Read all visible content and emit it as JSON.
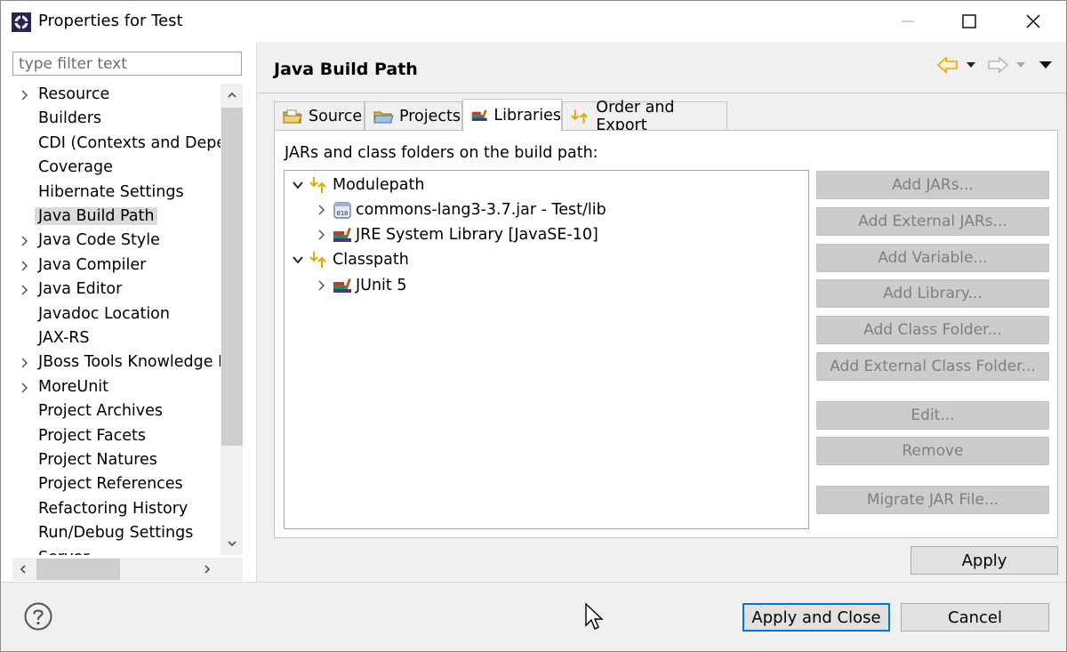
{
  "window": {
    "title": "Properties for Test"
  },
  "sidebar": {
    "filter_placeholder": "type filter text",
    "items": [
      {
        "label": "Resource",
        "expandable": true
      },
      {
        "label": "Builders",
        "expandable": false
      },
      {
        "label": "CDI (Contexts and Depen",
        "expandable": false
      },
      {
        "label": "Coverage",
        "expandable": false
      },
      {
        "label": "Hibernate Settings",
        "expandable": false
      },
      {
        "label": "Java Build Path",
        "expandable": false,
        "selected": true
      },
      {
        "label": "Java Code Style",
        "expandable": true
      },
      {
        "label": "Java Compiler",
        "expandable": true
      },
      {
        "label": "Java Editor",
        "expandable": true
      },
      {
        "label": "Javadoc Location",
        "expandable": false
      },
      {
        "label": "JAX-RS",
        "expandable": false
      },
      {
        "label": "JBoss Tools Knowledge B",
        "expandable": true
      },
      {
        "label": "MoreUnit",
        "expandable": true
      },
      {
        "label": "Project Archives",
        "expandable": false
      },
      {
        "label": "Project Facets",
        "expandable": false
      },
      {
        "label": "Project Natures",
        "expandable": false
      },
      {
        "label": "Project References",
        "expandable": false
      },
      {
        "label": "Refactoring History",
        "expandable": false
      },
      {
        "label": "Run/Debug Settings",
        "expandable": false
      },
      {
        "label": "Server",
        "expandable": false
      }
    ]
  },
  "main": {
    "title": "Java Build Path",
    "tabs": [
      {
        "label": "Source",
        "icon": "source-folder-icon"
      },
      {
        "label": "Projects",
        "icon": "projects-folder-icon"
      },
      {
        "label": "Libraries",
        "icon": "libraries-icon",
        "active": true
      },
      {
        "label": "Order and Export",
        "icon": "order-export-icon"
      }
    ],
    "build_path_label": "JARs and class folders on the build path:",
    "entries": [
      {
        "label": "Modulepath",
        "level": 0,
        "expanded": true,
        "icon": "modulepath-icon"
      },
      {
        "label": "commons-lang3-3.7.jar - Test/lib",
        "level": 1,
        "expanded": false,
        "icon": "jar-icon"
      },
      {
        "label": "JRE System Library [JavaSE-10]",
        "level": 1,
        "expanded": false,
        "icon": "library-icon"
      },
      {
        "label": "Classpath",
        "level": 0,
        "expanded": true,
        "icon": "classpath-icon"
      },
      {
        "label": "JUnit 5",
        "level": 1,
        "expanded": false,
        "icon": "library-icon"
      }
    ],
    "side_buttons": {
      "add_jars": "Add JARs...",
      "add_external_jars": "Add External JARs...",
      "add_variable": "Add Variable...",
      "add_library": "Add Library...",
      "add_class_folder": "Add Class Folder...",
      "add_external_class_folder": "Add External Class Folder...",
      "edit": "Edit...",
      "remove": "Remove",
      "migrate_jar": "Migrate JAR File..."
    },
    "apply": "Apply"
  },
  "footer": {
    "apply_and_close": "Apply and Close",
    "cancel": "Cancel"
  },
  "colors": {
    "accent": "#0078d7",
    "nav_arrow": "#e8a600",
    "selection": "#dadada",
    "disabled_button": "#cccccc"
  }
}
